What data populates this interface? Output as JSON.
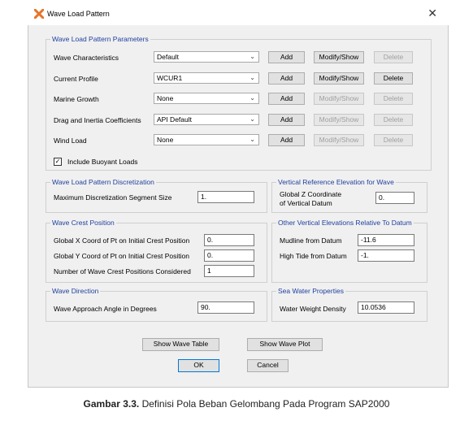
{
  "window": {
    "title": "Wave Load Pattern",
    "close_glyph": "✕"
  },
  "params": {
    "legend": "Wave Load Pattern Parameters",
    "rows": [
      {
        "label": "Wave Characteristics",
        "value": "Default",
        "add": "Add",
        "modify": "Modify/Show",
        "delete": "Delete",
        "modify_enabled": true,
        "delete_enabled": false
      },
      {
        "label": "Current Profile",
        "value": "WCUR1",
        "add": "Add",
        "modify": "Modify/Show",
        "delete": "Delete",
        "modify_enabled": true,
        "delete_enabled": true
      },
      {
        "label": "Marine Growth",
        "value": "None",
        "add": "Add",
        "modify": "Modify/Show",
        "delete": "Delete",
        "modify_enabled": false,
        "delete_enabled": false
      },
      {
        "label": "Drag and Inertia Coefficients",
        "value": "API Default",
        "add": "Add",
        "modify": "Modify/Show",
        "delete": "Delete",
        "modify_enabled": false,
        "delete_enabled": false
      },
      {
        "label": "Wind Load",
        "value": "None",
        "add": "Add",
        "modify": "Modify/Show",
        "delete": "Delete",
        "modify_enabled": false,
        "delete_enabled": false
      }
    ],
    "buoyant": {
      "label": "Include Buoyant Loads",
      "checked": true
    }
  },
  "discretization": {
    "legend": "Wave Load Pattern Discretization",
    "label": "Maximum Discretization Segment Size",
    "value": "1."
  },
  "vertical_ref": {
    "legend": "Vertical Reference Elevation for Wave",
    "label_line1": "Global Z Coordinate",
    "label_line2": "of Vertical Datum",
    "value": "0."
  },
  "crest": {
    "legend": "Wave Crest Position",
    "x_label": "Global X Coord of Pt on Initial Crest Position",
    "x_value": "0.",
    "y_label": "Global Y Coord of Pt on Initial Crest Position",
    "y_value": "0.",
    "n_label": "Number of Wave Crest Positions Considered",
    "n_value": "1"
  },
  "other_elev": {
    "legend": "Other Vertical Elevations Relative To Datum",
    "mudline_label": "Mudline from Datum",
    "mudline_value": "-11.6",
    "hightide_label": "High Tide from Datum",
    "hightide_value": "-1."
  },
  "direction": {
    "legend": "Wave Direction",
    "label": "Wave Approach Angle in Degrees",
    "value": "90."
  },
  "seawater": {
    "legend": "Sea Water Properties",
    "label": "Water Weight Density",
    "value": "10.0536"
  },
  "footer": {
    "show_table": "Show Wave Table",
    "show_plot": "Show Wave Plot",
    "ok": "OK",
    "cancel": "Cancel"
  },
  "caption": {
    "bold": "Gambar 3.3.",
    "text": " Definisi Pola Beban Gelombang Pada Program SAP2000"
  },
  "colors": {
    "legend_blue": "#1f3f9f",
    "icon_orange": "#e8742a"
  },
  "icons": {
    "app": "sap-x-icon",
    "dropdown": "chevron-down-icon",
    "check": "checkmark-icon"
  }
}
